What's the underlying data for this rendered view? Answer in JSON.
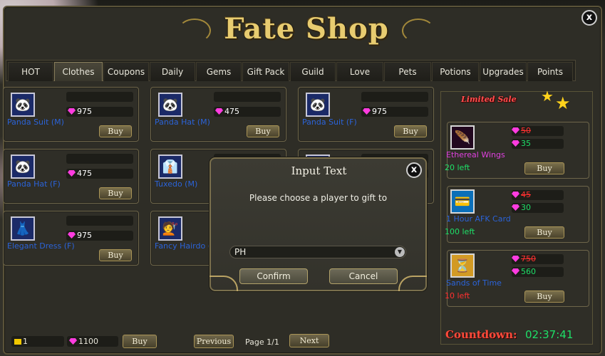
{
  "shop": {
    "title": "Fate Shop",
    "close": "x"
  },
  "tabs": [
    "HOT",
    "Clothes",
    "Coupons",
    "Daily",
    "Gems",
    "Gift Pack",
    "Guild",
    "Love",
    "Pets",
    "Potions",
    "Upgrades",
    "Points"
  ],
  "active_tab": "Clothes",
  "items": [
    {
      "name": "Panda Suit (M)",
      "price": "975",
      "buy": "Buy",
      "icon": "panda-suit-icon"
    },
    {
      "name": "Panda Hat (M)",
      "price": "475",
      "buy": "Buy",
      "icon": "panda-hat-icon"
    },
    {
      "name": "Panda Suit (F)",
      "price": "975",
      "buy": "Buy",
      "icon": "panda-suit-icon"
    },
    {
      "name": "Panda Hat (F)",
      "price": "475",
      "buy": "Buy",
      "icon": "panda-hat-icon"
    },
    {
      "name": "Tuxedo (M)",
      "price": "",
      "buy": "",
      "icon": "tuxedo-icon"
    },
    {
      "name": "",
      "price": "",
      "buy": "",
      "icon": "clothing-icon"
    },
    {
      "name": "Elegant Dress (F)",
      "price": "975",
      "buy": "Buy",
      "icon": "dress-icon"
    },
    {
      "name": "Fancy Hairdo (",
      "price": "",
      "buy": "",
      "icon": "hairdo-icon"
    }
  ],
  "limited_sale": {
    "title": "Limited Sale",
    "items": [
      {
        "name": "Ethereal Wings",
        "old_price": "50",
        "new_price": "35",
        "left": "20 left",
        "buy": "Buy",
        "name_color": "#e040e0",
        "left_color": "#1ee068",
        "icon": "wings-icon"
      },
      {
        "name": "1 Hour AFK Card",
        "old_price": "45",
        "new_price": "30",
        "left": "100 left",
        "buy": "Buy",
        "name_color": "#2b63d8",
        "left_color": "#1ee068",
        "icon": "afk-card-icon"
      },
      {
        "name": "Sands of Time",
        "old_price": "750",
        "new_price": "560",
        "left": "10 left",
        "buy": "Buy",
        "name_color": "#2b63d8",
        "left_color": "#ff3030",
        "icon": "sands-of-time-icon"
      }
    ],
    "countdown_label": "Countdown:",
    "countdown_time": "02:37:41"
  },
  "footer": {
    "coins": "1",
    "gems": "1100",
    "buy": "Buy",
    "previous": "Previous",
    "page": "Page 1/1",
    "next": "Next"
  },
  "dialog": {
    "title": "Input Text",
    "close": "x",
    "message": "Please choose a player to gift to",
    "selected_player": "PH",
    "confirm": "Confirm",
    "cancel": "Cancel"
  }
}
